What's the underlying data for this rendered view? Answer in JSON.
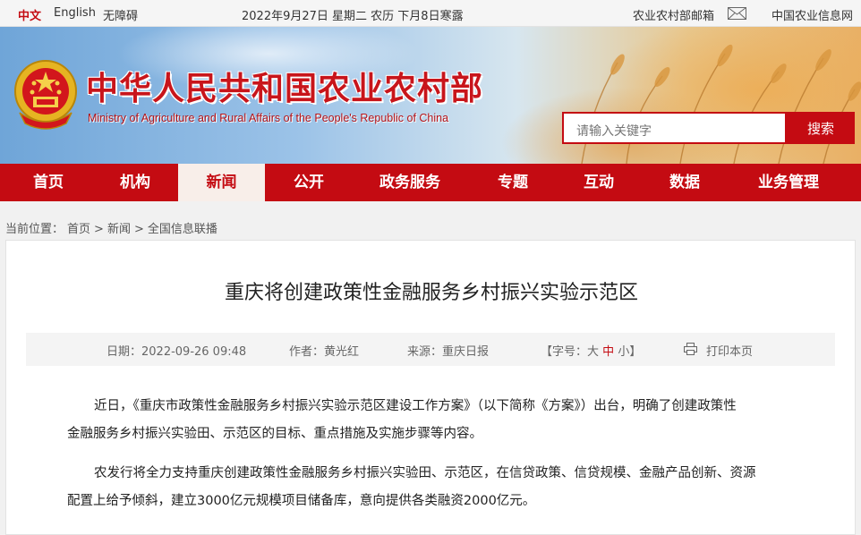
{
  "topbar": {
    "lang_zh": "中文",
    "lang_en": "English",
    "accessibility": "无障碍",
    "date": "2022年9月27日 星期二 农历 下月8日寒露",
    "mailbox": "农业农村部邮箱",
    "info_net": "中国农业信息网"
  },
  "header": {
    "title": "中华人民共和国农业农村部",
    "subtitle": "Ministry of Agriculture and Rural Affairs of the People's Republic of China",
    "search_placeholder": "请输入关键字",
    "search_button": "搜索"
  },
  "nav": {
    "items": [
      "首页",
      "机构",
      "新闻",
      "公开",
      "政务服务",
      "专题",
      "互动",
      "数据",
      "业务管理"
    ],
    "active_index": 2
  },
  "breadcrumb": {
    "items": [
      "当前位置：",
      "首页",
      ">",
      "新闻",
      ">",
      "全国信息联播"
    ]
  },
  "article": {
    "title": "重庆将创建政策性金融服务乡村振兴实验示范区",
    "date": "日期：2022-09-26 09:48",
    "author": "作者：黄光红",
    "source": "来源：重庆日报",
    "font_size_label": "【字号：",
    "font_large": "大",
    "font_medium": "中",
    "font_small": "小",
    "font_close": "】",
    "print": "打印本页",
    "para1_line1": "近日，《重庆市政策性金融服务乡村振兴实验示范区建设工作方案》（以下简称《方案》）出台，明确了创建政策性",
    "para1_line2": "金融服务乡村振兴实验田、示范区的目标、重点措施及实施步骤等内容。",
    "para2_line1": "农发行将全力支持重庆创建政策性金融服务乡村振兴实验田、示范区，在信贷政策、信贷规模、金融产品创新、资源",
    "para2_line2": "配置上给予倾斜，建立3000亿元规模项目储备库，意向提供各类融资2000亿元。"
  },
  "colors": {
    "brand_red": "#c40b12",
    "active_tab_bg": "#f8eee9",
    "meta_bg": "#f4f4f4"
  },
  "icons": [
    "mail-icon",
    "national-emblem-icon",
    "print-icon"
  ]
}
